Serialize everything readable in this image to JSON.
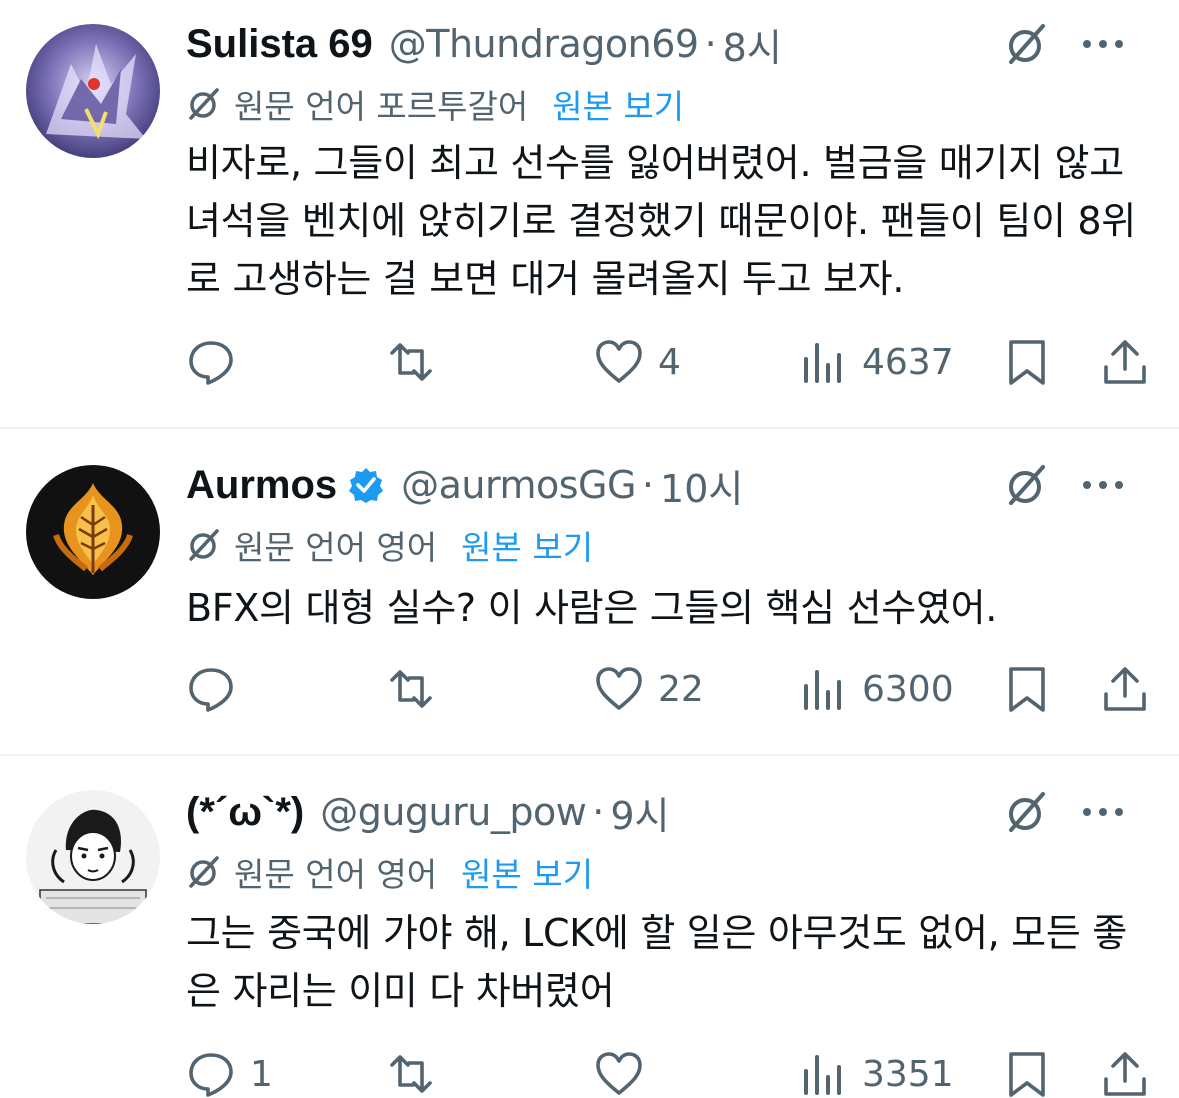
{
  "translate_show_original": "원본 보기",
  "tweets": [
    {
      "name": "Sulista 69",
      "verified": false,
      "handle": "@Thundragon69",
      "time": "8시",
      "lang_note": "원문 언어 포르투갈어",
      "text": "비자로, 그들이 최고 선수를 잃어버렸어. 벌금을 매기지 않고 녀석을 벤치에 앉히기로 결정했기 때문이야. 팬들이 팀이 8위로 고생하는 걸 보면 대거 몰려올지 두고 보자.",
      "replies": "",
      "retweets": "",
      "likes": "4",
      "views": "4637"
    },
    {
      "name": "Aurmos",
      "verified": true,
      "handle": "@aurmosGG",
      "time": "10시",
      "lang_note": "원문 언어 영어",
      "text": "BFX의 대형 실수? 이 사람은 그들의 핵심 선수였어.",
      "replies": "",
      "retweets": "",
      "likes": "22",
      "views": "6300"
    },
    {
      "name": "(*´ω`*)",
      "verified": false,
      "handle": "@guguru_pow",
      "time": "9시",
      "lang_note": "원문 언어 영어",
      "text": "그는 중국에 가야 해, LCK에 할 일은 아무것도 없어, 모든 좋은 자리는 이미 다 차버렸어",
      "replies": "1",
      "retweets": "",
      "likes": "",
      "views": "3351"
    }
  ],
  "colors": {
    "text": "#0f1419",
    "secondary": "#536471",
    "link": "#1d9bf0",
    "verified": "#1d9bf0",
    "divider": "#eff3f4"
  },
  "icons": [
    "grok-icon",
    "more-icon",
    "translate-icon",
    "reply-icon",
    "retweet-icon",
    "like-icon",
    "views-icon",
    "bookmark-icon",
    "share-icon",
    "verified-badge-icon"
  ]
}
